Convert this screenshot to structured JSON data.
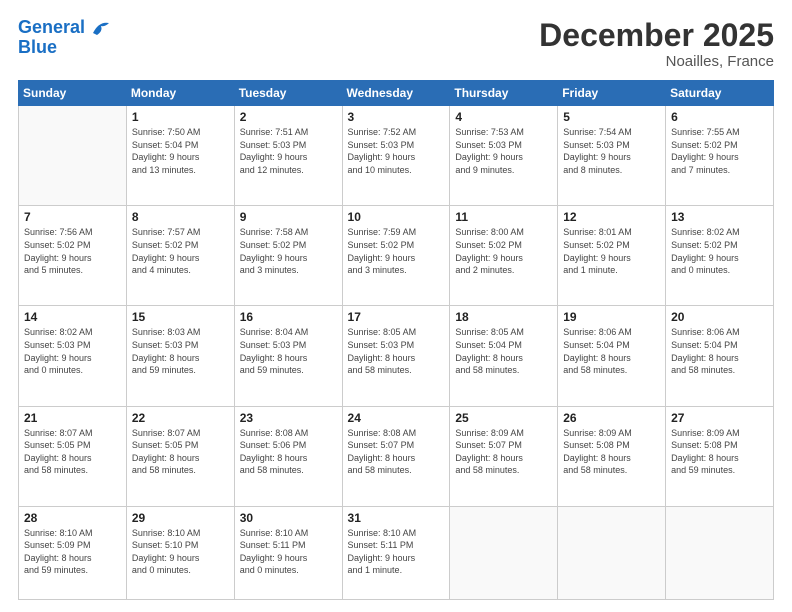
{
  "header": {
    "logo": {
      "line1": "General",
      "line2": "Blue"
    },
    "title": "December 2025",
    "location": "Noailles, France"
  },
  "weekdays": [
    "Sunday",
    "Monday",
    "Tuesday",
    "Wednesday",
    "Thursday",
    "Friday",
    "Saturday"
  ],
  "weeks": [
    [
      {
        "day": "",
        "info": ""
      },
      {
        "day": "1",
        "info": "Sunrise: 7:50 AM\nSunset: 5:04 PM\nDaylight: 9 hours\nand 13 minutes."
      },
      {
        "day": "2",
        "info": "Sunrise: 7:51 AM\nSunset: 5:03 PM\nDaylight: 9 hours\nand 12 minutes."
      },
      {
        "day": "3",
        "info": "Sunrise: 7:52 AM\nSunset: 5:03 PM\nDaylight: 9 hours\nand 10 minutes."
      },
      {
        "day": "4",
        "info": "Sunrise: 7:53 AM\nSunset: 5:03 PM\nDaylight: 9 hours\nand 9 minutes."
      },
      {
        "day": "5",
        "info": "Sunrise: 7:54 AM\nSunset: 5:03 PM\nDaylight: 9 hours\nand 8 minutes."
      },
      {
        "day": "6",
        "info": "Sunrise: 7:55 AM\nSunset: 5:02 PM\nDaylight: 9 hours\nand 7 minutes."
      }
    ],
    [
      {
        "day": "7",
        "info": "Sunrise: 7:56 AM\nSunset: 5:02 PM\nDaylight: 9 hours\nand 5 minutes."
      },
      {
        "day": "8",
        "info": "Sunrise: 7:57 AM\nSunset: 5:02 PM\nDaylight: 9 hours\nand 4 minutes."
      },
      {
        "day": "9",
        "info": "Sunrise: 7:58 AM\nSunset: 5:02 PM\nDaylight: 9 hours\nand 3 minutes."
      },
      {
        "day": "10",
        "info": "Sunrise: 7:59 AM\nSunset: 5:02 PM\nDaylight: 9 hours\nand 3 minutes."
      },
      {
        "day": "11",
        "info": "Sunrise: 8:00 AM\nSunset: 5:02 PM\nDaylight: 9 hours\nand 2 minutes."
      },
      {
        "day": "12",
        "info": "Sunrise: 8:01 AM\nSunset: 5:02 PM\nDaylight: 9 hours\nand 1 minute."
      },
      {
        "day": "13",
        "info": "Sunrise: 8:02 AM\nSunset: 5:02 PM\nDaylight: 9 hours\nand 0 minutes."
      }
    ],
    [
      {
        "day": "14",
        "info": "Sunrise: 8:02 AM\nSunset: 5:03 PM\nDaylight: 9 hours\nand 0 minutes."
      },
      {
        "day": "15",
        "info": "Sunrise: 8:03 AM\nSunset: 5:03 PM\nDaylight: 8 hours\nand 59 minutes."
      },
      {
        "day": "16",
        "info": "Sunrise: 8:04 AM\nSunset: 5:03 PM\nDaylight: 8 hours\nand 59 minutes."
      },
      {
        "day": "17",
        "info": "Sunrise: 8:05 AM\nSunset: 5:03 PM\nDaylight: 8 hours\nand 58 minutes."
      },
      {
        "day": "18",
        "info": "Sunrise: 8:05 AM\nSunset: 5:04 PM\nDaylight: 8 hours\nand 58 minutes."
      },
      {
        "day": "19",
        "info": "Sunrise: 8:06 AM\nSunset: 5:04 PM\nDaylight: 8 hours\nand 58 minutes."
      },
      {
        "day": "20",
        "info": "Sunrise: 8:06 AM\nSunset: 5:04 PM\nDaylight: 8 hours\nand 58 minutes."
      }
    ],
    [
      {
        "day": "21",
        "info": "Sunrise: 8:07 AM\nSunset: 5:05 PM\nDaylight: 8 hours\nand 58 minutes."
      },
      {
        "day": "22",
        "info": "Sunrise: 8:07 AM\nSunset: 5:05 PM\nDaylight: 8 hours\nand 58 minutes."
      },
      {
        "day": "23",
        "info": "Sunrise: 8:08 AM\nSunset: 5:06 PM\nDaylight: 8 hours\nand 58 minutes."
      },
      {
        "day": "24",
        "info": "Sunrise: 8:08 AM\nSunset: 5:07 PM\nDaylight: 8 hours\nand 58 minutes."
      },
      {
        "day": "25",
        "info": "Sunrise: 8:09 AM\nSunset: 5:07 PM\nDaylight: 8 hours\nand 58 minutes."
      },
      {
        "day": "26",
        "info": "Sunrise: 8:09 AM\nSunset: 5:08 PM\nDaylight: 8 hours\nand 58 minutes."
      },
      {
        "day": "27",
        "info": "Sunrise: 8:09 AM\nSunset: 5:08 PM\nDaylight: 8 hours\nand 59 minutes."
      }
    ],
    [
      {
        "day": "28",
        "info": "Sunrise: 8:10 AM\nSunset: 5:09 PM\nDaylight: 8 hours\nand 59 minutes."
      },
      {
        "day": "29",
        "info": "Sunrise: 8:10 AM\nSunset: 5:10 PM\nDaylight: 9 hours\nand 0 minutes."
      },
      {
        "day": "30",
        "info": "Sunrise: 8:10 AM\nSunset: 5:11 PM\nDaylight: 9 hours\nand 0 minutes."
      },
      {
        "day": "31",
        "info": "Sunrise: 8:10 AM\nSunset: 5:11 PM\nDaylight: 9 hours\nand 1 minute."
      },
      {
        "day": "",
        "info": ""
      },
      {
        "day": "",
        "info": ""
      },
      {
        "day": "",
        "info": ""
      }
    ]
  ]
}
